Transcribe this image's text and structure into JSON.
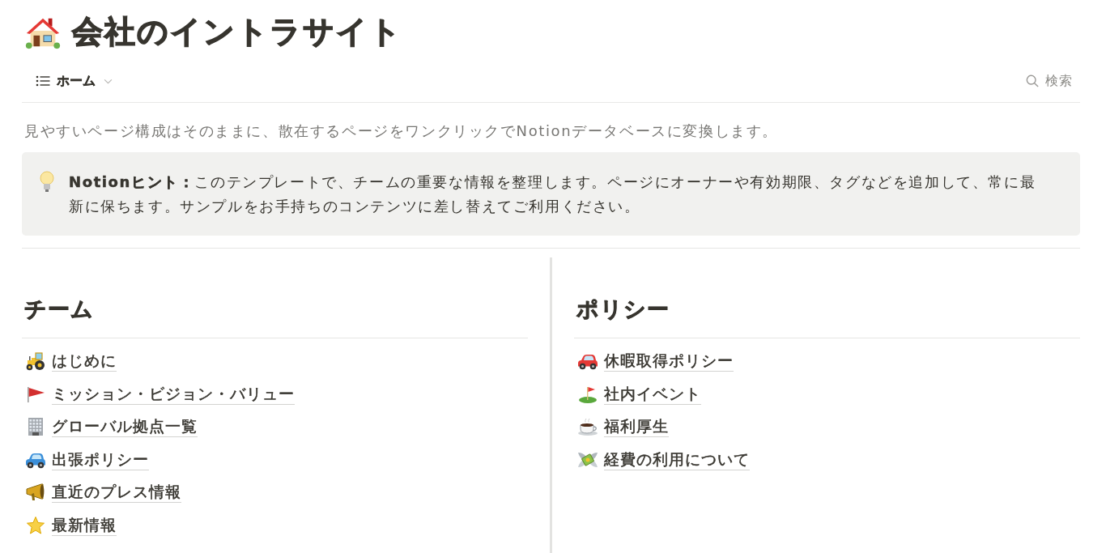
{
  "page": {
    "title": "会社のイントラサイト"
  },
  "nav": {
    "menu": "ホーム",
    "search": "検索"
  },
  "description": "見やすいページ構成はそのままに、散在するページをワンクリックでNotionデータベースに変換します。",
  "callout": {
    "text": "**Notionヒント：**このテンプレートで、チームの重要な情報を整理します。ページにオーナーや有効期限、タグなどを追加して、常に最新に保ちます。サンプルをお手持ちのコンテンツに差し替えてご利用ください。"
  },
  "columns": [
    {
      "heading": "チーム",
      "links": [
        {
          "label": "はじめに"
        },
        {
          "label": "ミッション・ビジョン・バリュー"
        },
        {
          "label": "グローバル拠点一覧"
        },
        {
          "label": "出張ポリシー"
        },
        {
          "label": "直近のプレス情報"
        },
        {
          "label": "最新情報"
        }
      ]
    },
    {
      "heading": "ポリシー",
      "links": [
        {
          "label": "休暇取得ポリシー"
        },
        {
          "label": "社内イベント"
        },
        {
          "label": "福利厚生"
        },
        {
          "label": "経費の利用について"
        }
      ]
    }
  ]
}
